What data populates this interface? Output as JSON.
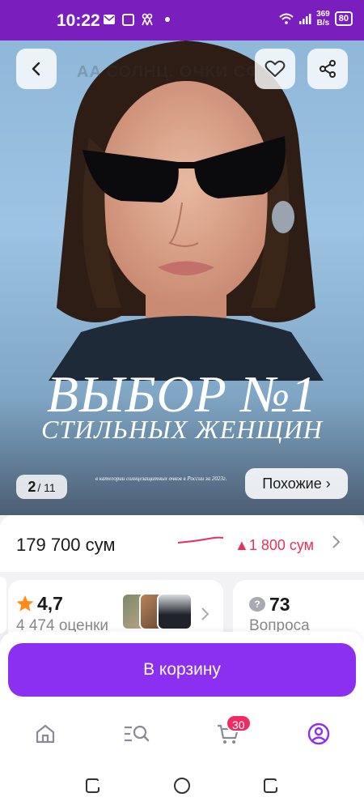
{
  "status_bar": {
    "time": "10:22",
    "net_speed_value": "369",
    "net_speed_unit": "B/s",
    "battery": "80"
  },
  "hero": {
    "watermark": "AA СОЛНЦ. ОЧКИ СФ",
    "title": "ВЫБОР №1",
    "subtitle": "СТИЛЬНЫХ ЖЕНЩИН",
    "note": "в категории солнцезащитных очков в России за 2023г.",
    "current_image": "2",
    "total_images": "11",
    "similar_label": "Похожие ›"
  },
  "price": {
    "current": "179 700 сум",
    "change": "▲1 800 сум"
  },
  "rating": {
    "value": "4,7",
    "count": "4 474 оценки"
  },
  "questions": {
    "count": "73",
    "label": "Вопроса"
  },
  "cart": {
    "button_label": "В корзину"
  },
  "tabbar": {
    "cart_badge": "30",
    "accent_color": "#8b2ff0"
  },
  "colors": {
    "status_bar": "#7a1fbd",
    "primary": "#8b2ff0",
    "price_up": "#e8305a",
    "badge": "#ef2b64"
  }
}
